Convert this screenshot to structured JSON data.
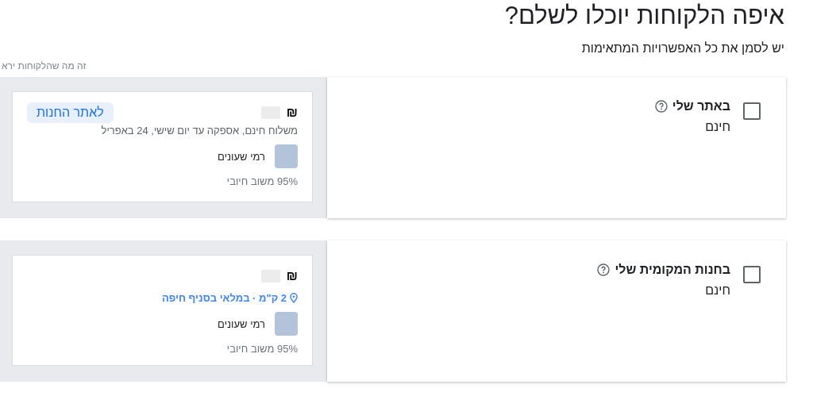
{
  "title": "איפה הלקוחות יוכלו לשלם?",
  "subtitle": "יש לסמן את כל האפשרויות המתאימות",
  "preview_caption": "זה מה שהלקוחות ירא",
  "options": [
    {
      "label": "באתר שלי",
      "price": "חינם",
      "checked": false,
      "preview": {
        "kind": "online",
        "currency": "₪",
        "button": "לאתר החנות",
        "detail": "משלוח חינם, אספקה עד יום שישי, 24 באפריל",
        "seller": "רמי שעונים",
        "rating": "95% משוב חיובי"
      }
    },
    {
      "label": "בחנות המקומית שלי",
      "price": "חינם",
      "checked": false,
      "preview": {
        "kind": "local",
        "currency": "₪",
        "detail": "2 ק\"מ · במלאי בסניף חיפה",
        "seller": "רמי שעונים",
        "rating": "95% משוב חיובי"
      }
    }
  ]
}
